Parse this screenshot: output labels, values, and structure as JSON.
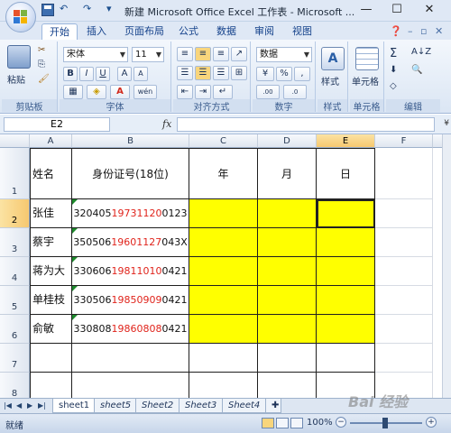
{
  "window": {
    "title": "新建 Microsoft Office Excel 工作表 - Microsoft ...",
    "controls": [
      "—",
      "☐",
      "✕"
    ]
  },
  "quick_access": [
    "↶",
    "↷",
    "▾"
  ],
  "ribbon_tabs": [
    "开始",
    "插入",
    "页面布局",
    "公式",
    "数据",
    "审阅",
    "视图"
  ],
  "ribbon": {
    "clipboard": {
      "paste": "粘贴",
      "label": "剪贴板"
    },
    "font": {
      "name": "宋体",
      "size": "11",
      "bold": "B",
      "italic": "I",
      "underline": "U",
      "grow": "A",
      "shrink": "A",
      "label": "字体",
      "wen": "wén"
    },
    "alignment": {
      "label": "对齐方式"
    },
    "number": {
      "format": "数据",
      "percent": "%",
      "comma": ",",
      "label": "数字"
    },
    "styles": {
      "label": "样式",
      "button": "样式"
    },
    "cells": {
      "label": "单元格",
      "button": "单元格"
    },
    "editing": {
      "label": "编辑",
      "sum": "Σ"
    }
  },
  "formula_bar": {
    "name_box": "E2",
    "fx": "fx",
    "value": ""
  },
  "columns": [
    "A",
    "B",
    "C",
    "D",
    "E",
    "F"
  ],
  "rows": [
    "1",
    "2",
    "3",
    "4",
    "5",
    "6",
    "7",
    "8"
  ],
  "headers": {
    "a": "姓名",
    "b": "身份证号(18位)",
    "c": "年",
    "d": "月",
    "e": "日"
  },
  "records": [
    {
      "name": "张佳",
      "id_pre": "320405",
      "id_mid": "19731120",
      "id_post": "0123"
    },
    {
      "name": "蔡宇",
      "id_pre": "350506",
      "id_mid": "19601127",
      "id_post": "043X"
    },
    {
      "name": "蒋为大",
      "id_pre": "330606",
      "id_mid": "19811010",
      "id_post": "0421"
    },
    {
      "name": "单桂枝",
      "id_pre": "330506",
      "id_mid": "19850909",
      "id_post": "0421"
    },
    {
      "name": "俞敏",
      "id_pre": "330808",
      "id_mid": "19860808",
      "id_post": "0421"
    }
  ],
  "sheet_tabs": [
    "sheet1",
    "sheet5",
    "Sheet2",
    "Sheet3",
    "Sheet4"
  ],
  "status": {
    "text": "就绪",
    "zoom": "100%",
    "minus": "−",
    "plus": "+"
  },
  "watermark": "Bai 经验",
  "colors": {
    "highlight": "#ffff00",
    "id_accent": "#e0241c",
    "ribbon": "#dfe8f5"
  }
}
